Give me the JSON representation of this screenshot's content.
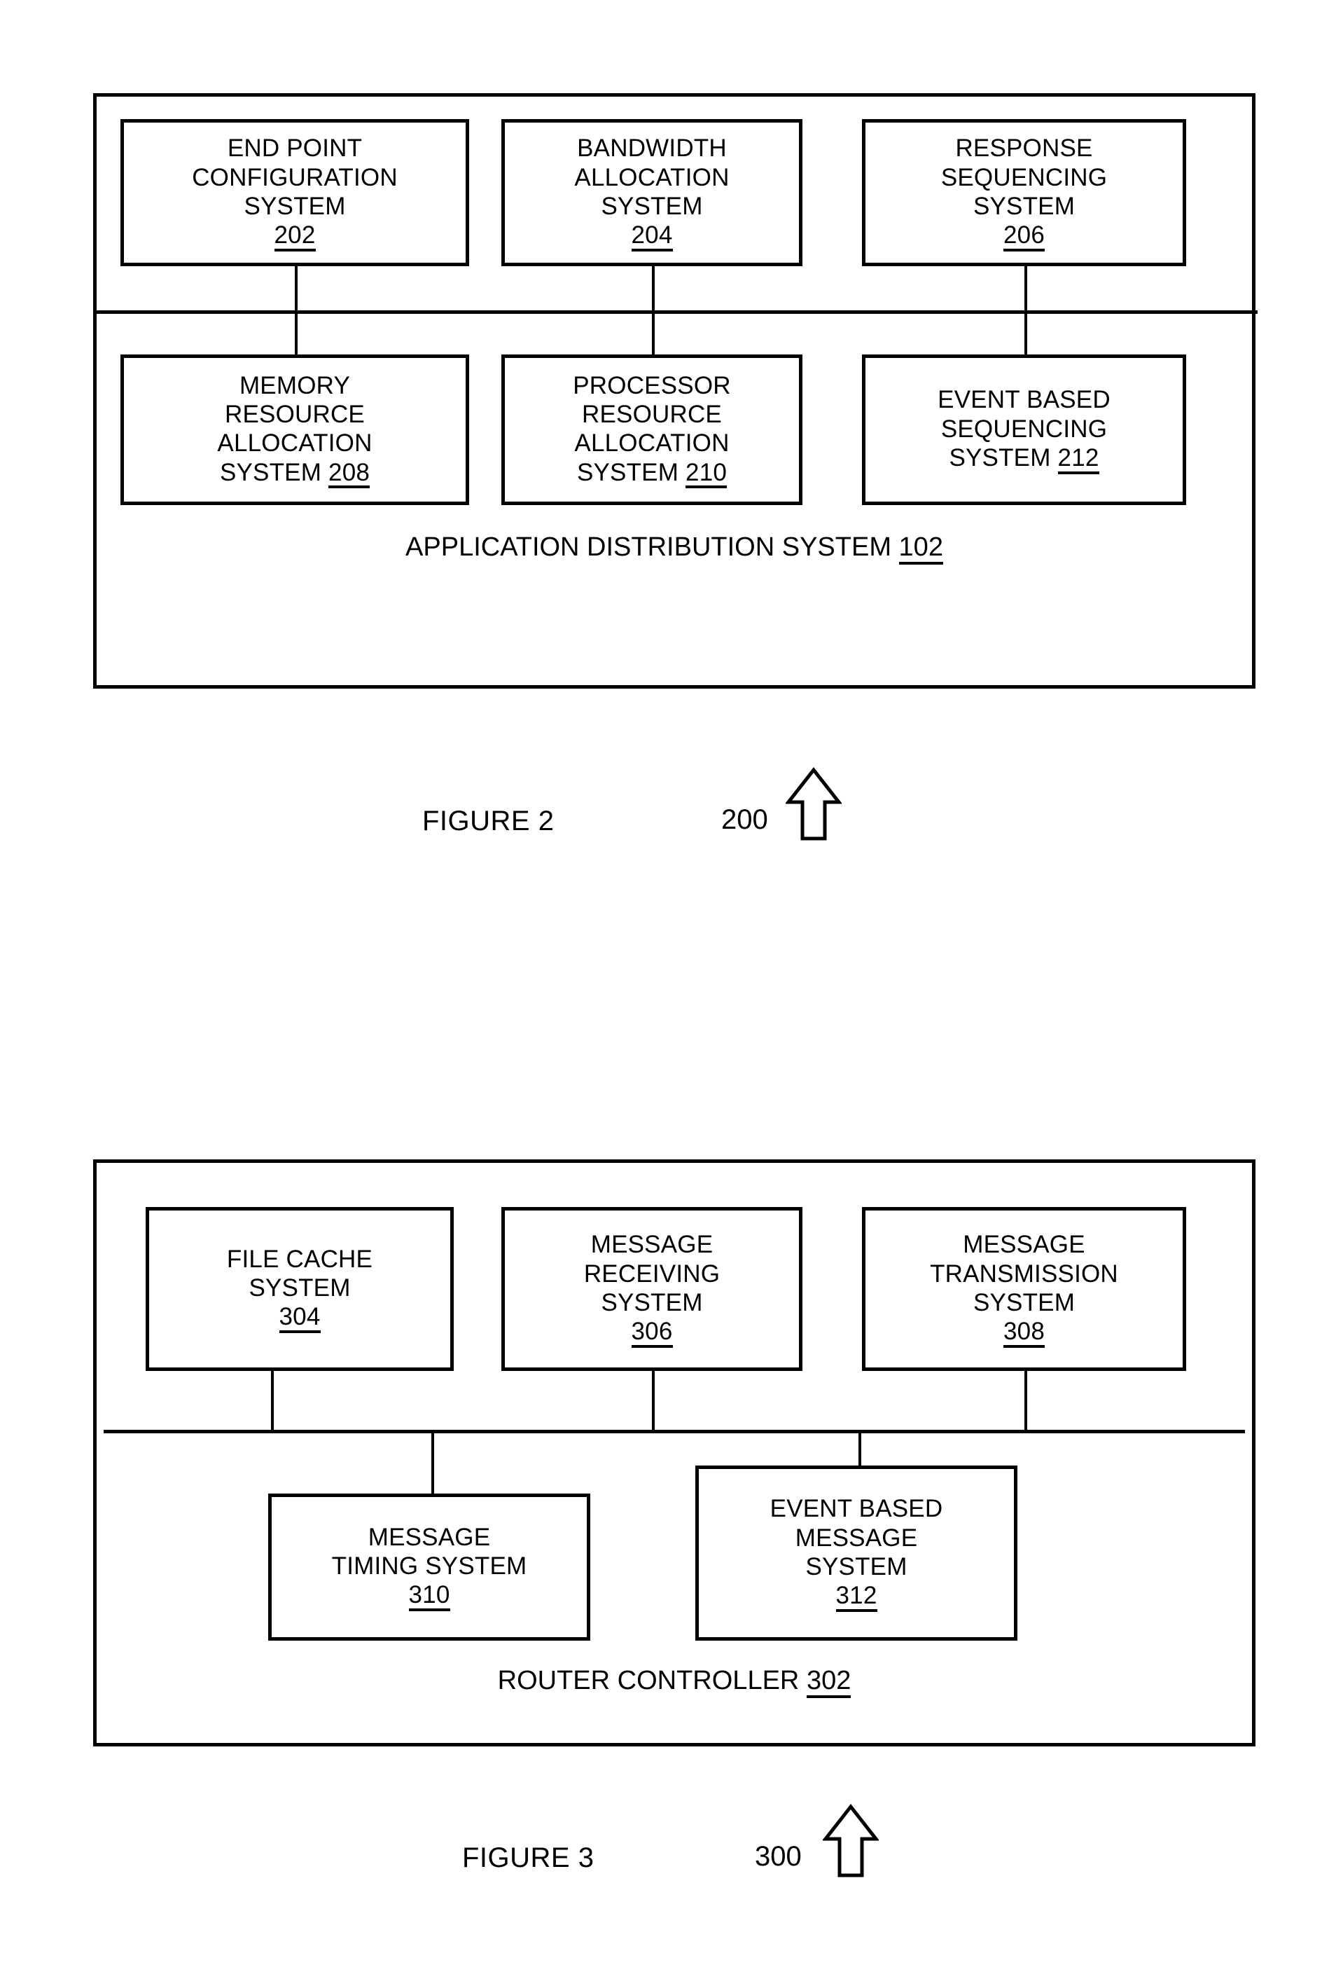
{
  "document": {
    "type": "patent-drawing-sheet",
    "figures": [
      {
        "id": "figure-2",
        "caption": "FIGURE 2",
        "reference_numeral": "200",
        "arrow": "up-arrow-icon",
        "container_label_text": "APPLICATION DISTRIBUTION SYSTEM",
        "container_label_number": "102",
        "bus": {
          "orientation": "horizontal",
          "taps": 6
        },
        "boxes": [
          {
            "id": "box-202",
            "lines": [
              "END POINT",
              "CONFIGURATION",
              "SYSTEM"
            ],
            "number": "202",
            "number_inline": false
          },
          {
            "id": "box-204",
            "lines": [
              "BANDWIDTH",
              "ALLOCATION",
              "SYSTEM"
            ],
            "number": "204",
            "number_inline": false
          },
          {
            "id": "box-206",
            "lines": [
              "RESPONSE",
              "SEQUENCING",
              "SYSTEM"
            ],
            "number": "206",
            "number_inline": false
          },
          {
            "id": "box-208",
            "lines": [
              "MEMORY",
              "RESOURCE",
              "ALLOCATION",
              "SYSTEM"
            ],
            "number": "208",
            "number_inline": true
          },
          {
            "id": "box-210",
            "lines": [
              "PROCESSOR",
              "RESOURCE",
              "ALLOCATION",
              "SYSTEM"
            ],
            "number": "210",
            "number_inline": true
          },
          {
            "id": "box-212",
            "lines": [
              "EVENT BASED",
              "SEQUENCING",
              "SYSTEM"
            ],
            "number": "212",
            "number_inline": true
          }
        ]
      },
      {
        "id": "figure-3",
        "caption": "FIGURE 3",
        "reference_numeral": "300",
        "arrow": "up-arrow-icon",
        "container_label_text": "ROUTER CONTROLLER",
        "container_label_number": "302",
        "bus": {
          "orientation": "horizontal",
          "taps": 5
        },
        "boxes": [
          {
            "id": "box-304",
            "lines": [
              "FILE CACHE",
              "SYSTEM"
            ],
            "number": "304",
            "number_inline": false
          },
          {
            "id": "box-306",
            "lines": [
              "MESSAGE",
              "RECEIVING",
              "SYSTEM"
            ],
            "number": "306",
            "number_inline": false
          },
          {
            "id": "box-308",
            "lines": [
              "MESSAGE",
              "TRANSMISSION",
              "SYSTEM"
            ],
            "number": "308",
            "number_inline": false
          },
          {
            "id": "box-310",
            "lines": [
              "MESSAGE",
              "TIMING SYSTEM"
            ],
            "number": "310",
            "number_inline": false
          },
          {
            "id": "box-312",
            "lines": [
              "EVENT BASED",
              "MESSAGE",
              "SYSTEM"
            ],
            "number": "312",
            "number_inline": false
          }
        ]
      }
    ],
    "colors": {
      "ink": "#000000",
      "paper": "#ffffff"
    }
  }
}
